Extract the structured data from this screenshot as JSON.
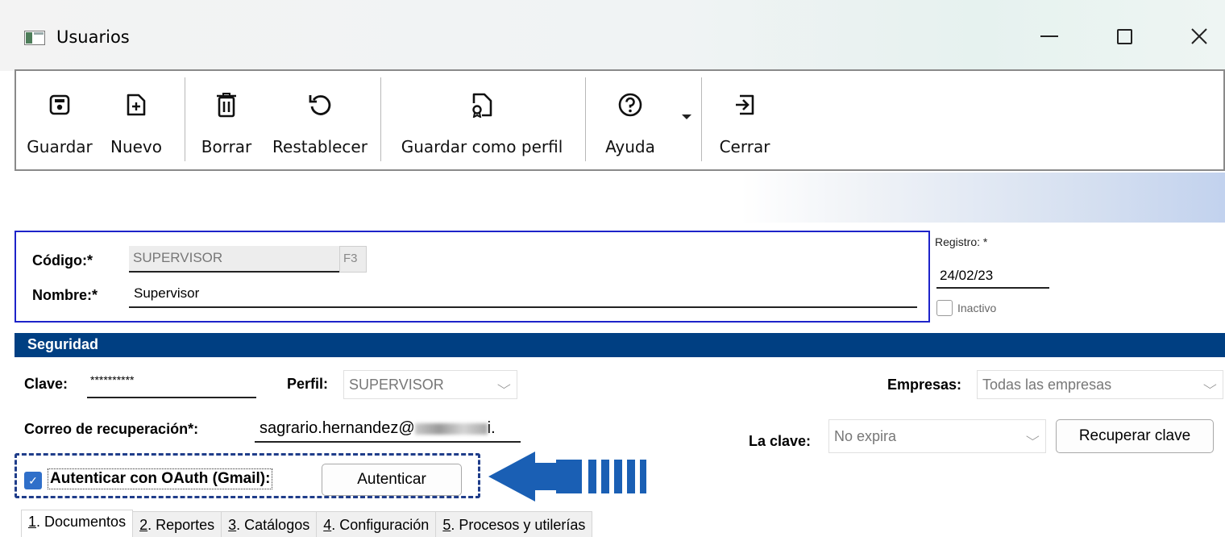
{
  "window": {
    "title": "Usuarios",
    "controls": [
      "—",
      "☐",
      "✕"
    ]
  },
  "toolbar": {
    "buttons": [
      {
        "label": "Guardar",
        "icon": "save-icon"
      },
      {
        "label": "Nuevo",
        "icon": "new-document-icon"
      },
      {
        "label": "Borrar",
        "icon": "trash-icon"
      },
      {
        "label": "Restablecer",
        "icon": "undo-icon"
      },
      {
        "label": "Guardar como perfil",
        "icon": "save-profile-icon"
      },
      {
        "label": "Ayuda",
        "icon": "help-icon"
      },
      {
        "label": "Cerrar",
        "icon": "exit-icon"
      }
    ]
  },
  "header": {
    "codigo_label": "Código:*",
    "codigo_value": "SUPERVISOR",
    "f3_label": "F3",
    "nombre_label": "Nombre:*",
    "nombre_value": "Supervisor",
    "registro_label": "Registro: *",
    "registro_value": "24/02/23",
    "inactivo_label": "Inactivo",
    "inactivo_checked": false
  },
  "security": {
    "section_title": "Seguridad",
    "clave_label": "Clave:",
    "clave_value": "**********",
    "perfil_label": "Perfil:",
    "perfil_value": "SUPERVISOR",
    "empresas_label": "Empresas:",
    "empresas_value": "Todas las empresas",
    "correo_label": "Correo de recuperación*:",
    "correo_value": "sagrario.hernandez@",
    "correo_suffix": "i.",
    "la_clave_label": "La clave:",
    "la_clave_value": "No expira",
    "recuperar_label": "Recuperar clave",
    "oauth_label": "Autenticar con OAuth (Gmail):",
    "oauth_checked": true,
    "autenticar_label": "Autenticar"
  },
  "tabs": [
    {
      "num": "1",
      "label": ". Documentos",
      "active": true
    },
    {
      "num": "2",
      "label": ". Reportes",
      "active": false
    },
    {
      "num": "3",
      "label": ". Catálogos",
      "active": false
    },
    {
      "num": "4",
      "label": ". Configuración",
      "active": false
    },
    {
      "num": "5",
      "label": ". Procesos y utilerías",
      "active": false
    }
  ],
  "colors": {
    "section_bg": "#003f82",
    "header_border": "#1d23c9",
    "arrow": "#1a5fb4",
    "checkbox": "#2f6fc9"
  }
}
